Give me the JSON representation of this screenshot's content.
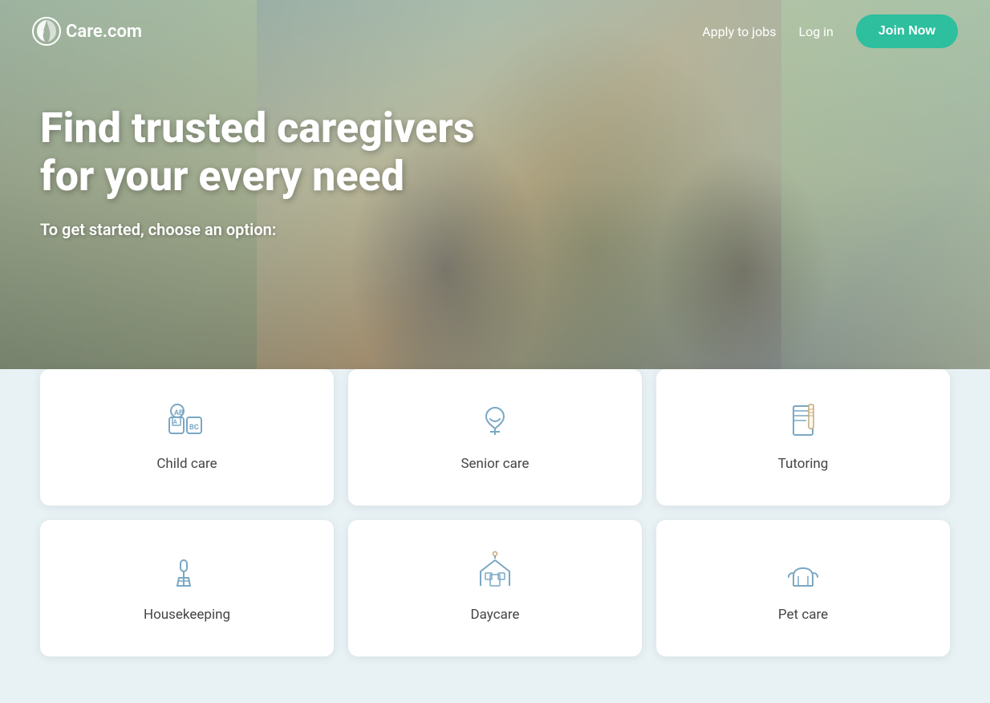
{
  "header": {
    "logo_text": "Care.com",
    "nav": {
      "apply_label": "Apply to jobs",
      "login_label": "Log in",
      "join_label": "Join Now"
    }
  },
  "hero": {
    "title": "Find trusted caregivers for your every need",
    "subtitle": "To get started, choose an option:"
  },
  "cards": {
    "row1": [
      {
        "id": "child-care",
        "label": "Child care"
      },
      {
        "id": "senior-care",
        "label": "Senior care"
      },
      {
        "id": "tutoring",
        "label": "Tutoring"
      }
    ],
    "row2": [
      {
        "id": "housekeeping",
        "label": "Housekeeping"
      },
      {
        "id": "daycare",
        "label": "Daycare"
      },
      {
        "id": "pet-care",
        "label": "Pet care"
      }
    ]
  }
}
